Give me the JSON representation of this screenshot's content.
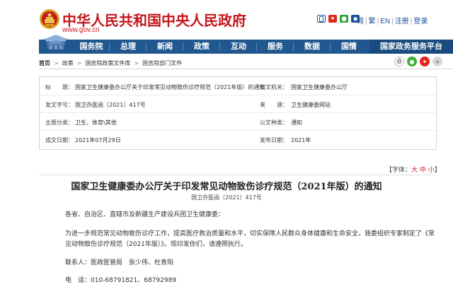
{
  "header": {
    "site_title": "中华人民共和国中央人民政府",
    "site_url": "www.gov.cn",
    "top_links": [
      "简",
      "繁",
      "EN",
      "注册",
      "登录"
    ]
  },
  "nav": {
    "items": [
      "国务院",
      "总理",
      "新闻",
      "政策",
      "互动",
      "服务",
      "数据",
      "国情"
    ],
    "platform": "国家政务服务平台"
  },
  "breadcrumb": [
    "首页",
    "政策",
    "国务院政策文件库",
    "国务院部门文件"
  ],
  "info": {
    "title_label": "标　　题：",
    "title_value": "国家卫生健康委办公厅关于印发常见动物致伤诊疗规范（2021年版）的通知",
    "issuer_label": "发文机关：",
    "issuer_value": "国家卫生健康委办公厅",
    "docno_label": "发文字号：",
    "docno_value": "国卫办医函〔2021〕417号",
    "source_label": "来　　源：",
    "source_value": "卫生健康委网站",
    "topic_label": "主题分类：",
    "topic_value": "卫生、体育\\其他",
    "type_label": "公文种类：",
    "type_value": "通知",
    "written_label": "成文日期：",
    "written_value": "2021年07月29日",
    "publish_label": "发布日期：",
    "publish_value": "2021年"
  },
  "fontsize": {
    "prefix": "【字体：",
    "big": "大",
    "mid": "中",
    "small": "小",
    "suffix": "】"
  },
  "article": {
    "title": "国家卫生健康委办公厅关于印发常见动物致伤诊疗规范（2021年版）的通知",
    "docno": "国卫办医函〔2021〕417号",
    "salutation": "各省、自治区、直辖市及新疆生产建设兵团卫生健康委：",
    "para_line1": "为进一步规范常见动物致伤诊疗工作，提高医疗救治质量和水平，切实保障人民群众身体健康和生命安全，我委组织专家制定了《常",
    "para_line2": "见动物致伤诊疗规范（2021年版）》。现印发你们，请遵照执行。",
    "contact": "联系人：医政医管局　张少伟、杜青阳",
    "phone": "电　话：010-68791821、68792989"
  },
  "colors": {
    "brand_red": "#c4161c",
    "nav_blue": "#21578f",
    "link_blue": "#1a4f9c"
  }
}
